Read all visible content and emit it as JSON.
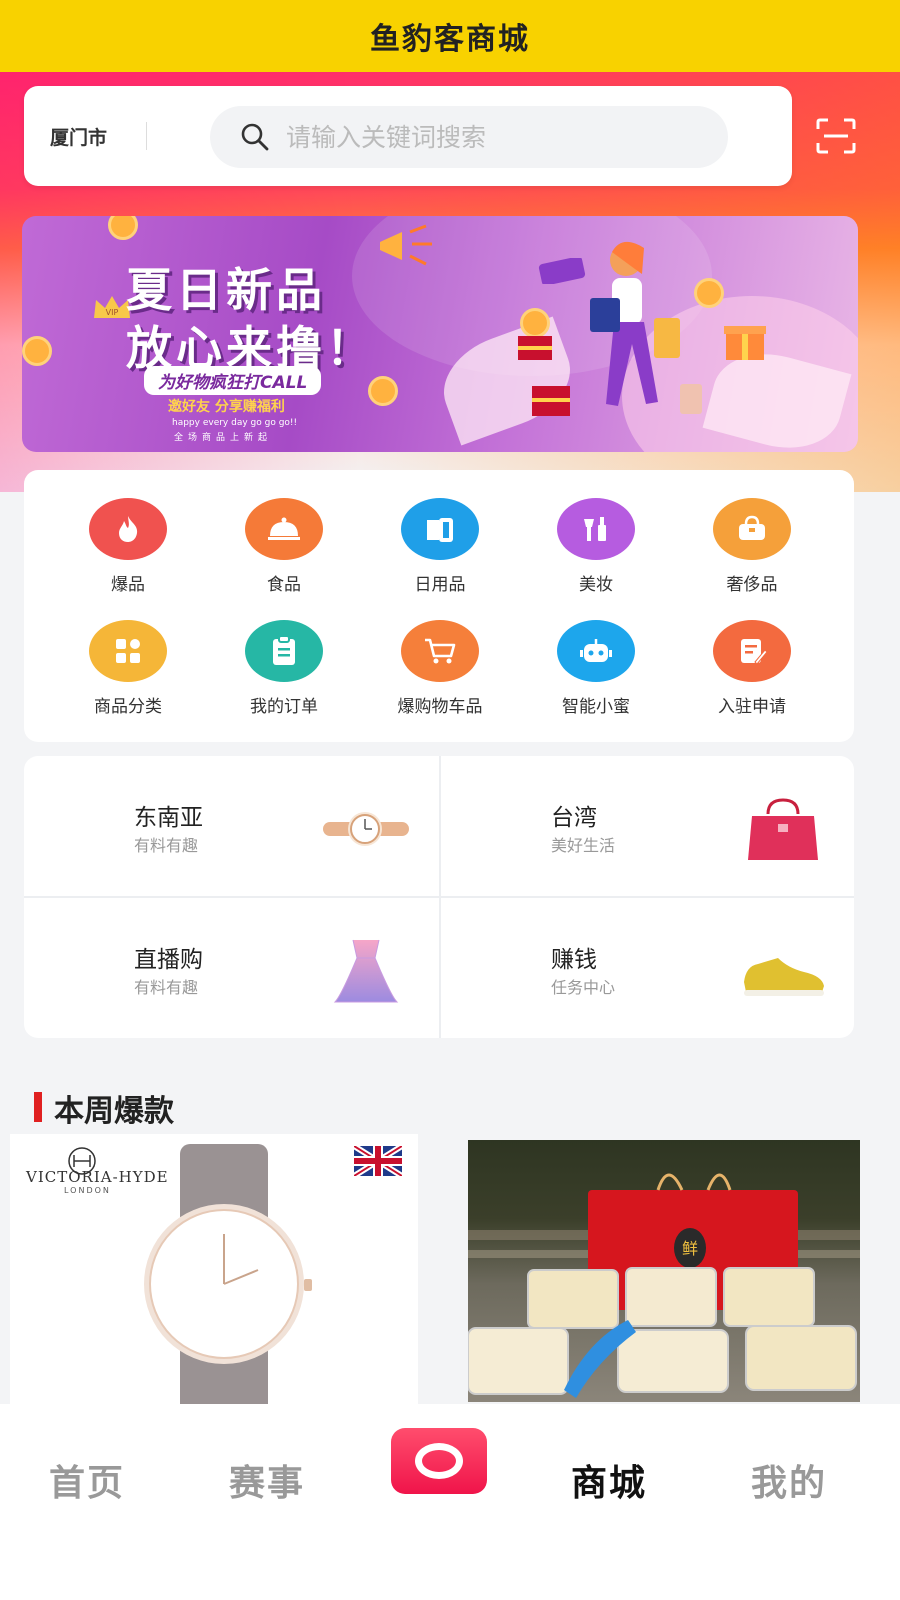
{
  "header": {
    "title": "鱼豹客商城"
  },
  "search": {
    "city": "厦门市",
    "placeholder": "请输入关键词搜索"
  },
  "banner": {
    "headline_1": "夏日新品",
    "headline_2": "放心来撸！",
    "tag": "为好物疯狂打CALL",
    "sub": "邀好友 分享赚福利",
    "tiny_1": "happy every day go go go!!",
    "tiny_2": "全场商品上新起",
    "crown_text": "VIP"
  },
  "categories": [
    {
      "label": "爆品",
      "color": "#f0524f",
      "icon": "fire-icon"
    },
    {
      "label": "食品",
      "color": "#f57a38",
      "icon": "food-cover-icon"
    },
    {
      "label": "日用品",
      "color": "#1f9fe8",
      "icon": "tissue-icon"
    },
    {
      "label": "美妆",
      "color": "#b65ce0",
      "icon": "cosmetics-icon"
    },
    {
      "label": "奢侈品",
      "color": "#f5a03a",
      "icon": "handbag-icon"
    },
    {
      "label": "商品分类",
      "color": "#f5b638",
      "icon": "grid-icon"
    },
    {
      "label": "我的订单",
      "color": "#26b7a5",
      "icon": "clipboard-icon"
    },
    {
      "label": "爆购物车品",
      "color": "#f57f3a",
      "icon": "cart-icon"
    },
    {
      "label": "智能小蜜",
      "color": "#1da6ec",
      "icon": "robot-icon"
    },
    {
      "label": "入驻申请",
      "color": "#f36a3f",
      "icon": "form-icon"
    }
  ],
  "tiles": [
    {
      "title": "东南亚",
      "sub": "有料有趣",
      "img": "watch-icon"
    },
    {
      "title": "台湾",
      "sub": "美好生活",
      "img": "handbag-icon"
    },
    {
      "title": "直播购",
      "sub": "有料有趣",
      "img": "dress-icon"
    },
    {
      "title": "赚钱",
      "sub": "任务中心",
      "img": "sneaker-icon"
    }
  ],
  "section": {
    "title": "本周爆款"
  },
  "products": [
    {
      "brand": "VICTORIA-HYDE",
      "brand_sub": "LONDON",
      "image": "watch-photo"
    },
    {
      "box_text": "鲜",
      "image": "bird-nest-photo"
    }
  ],
  "nav": {
    "home": "首页",
    "events": "赛事",
    "mall": "商城",
    "mine": "我的"
  }
}
